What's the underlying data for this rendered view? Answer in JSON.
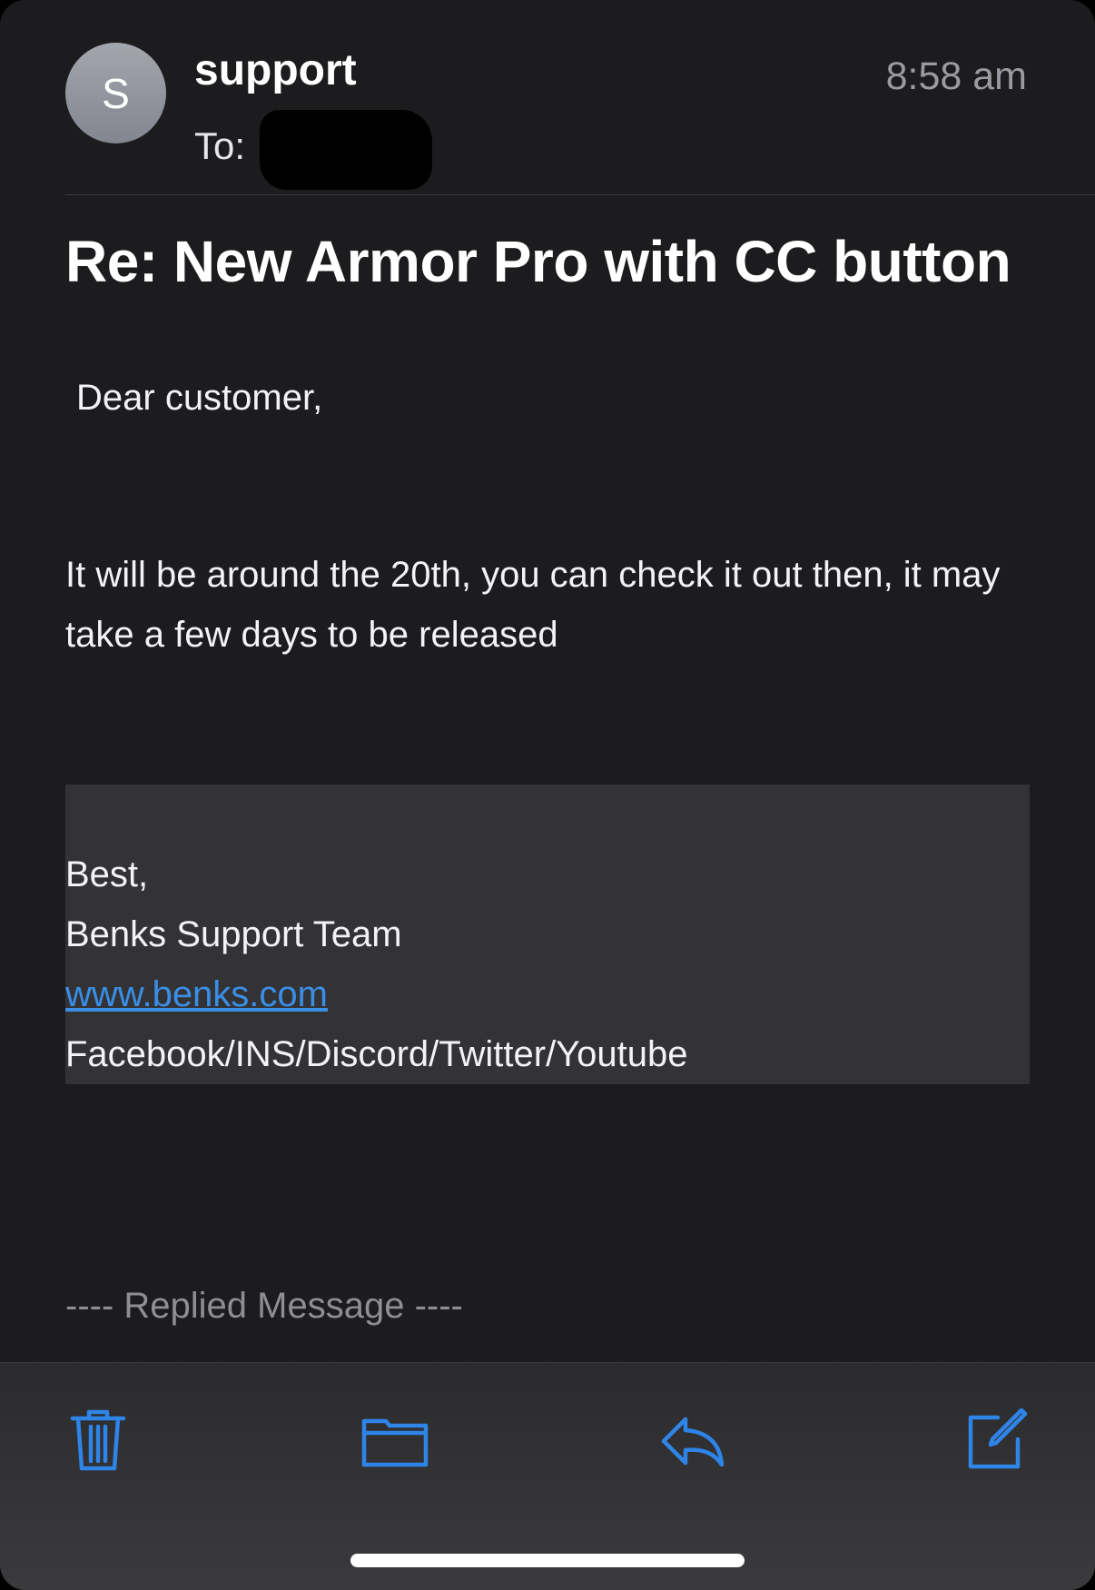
{
  "email": {
    "avatar_initial": "S",
    "sender": "support",
    "to_label": "To:",
    "time": "8:58 am",
    "subject": "Re: New Armor Pro with CC button",
    "greeting": "Dear customer,",
    "paragraph": "It will be around the 20th, you can check it out then, it may take a few days to be released",
    "signature": {
      "closing": "Best,",
      "team": "Benks Support Team",
      "website": "www.benks.com",
      "socials": "Facebook/INS/Discord/Twitter/Youtube"
    },
    "replied_marker": "---- Replied Message ----"
  },
  "toolbar": {
    "buttons": [
      {
        "name": "delete",
        "icon": "trash-icon"
      },
      {
        "name": "move",
        "icon": "folder-icon"
      },
      {
        "name": "reply",
        "icon": "reply-icon"
      },
      {
        "name": "compose",
        "icon": "compose-icon"
      }
    ]
  },
  "colors": {
    "background": "#1c1c1e",
    "accent": "#2f84e8",
    "link": "#3a8ee6",
    "secondary_text": "#8e8e93"
  }
}
